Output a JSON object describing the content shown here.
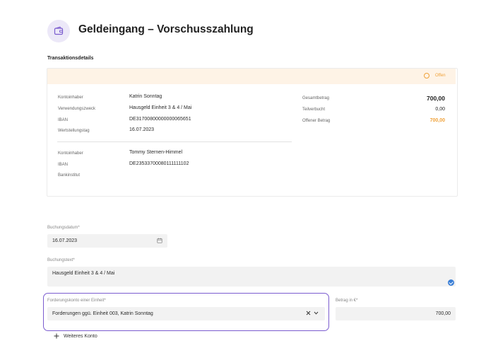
{
  "page": {
    "title": "Geldeingang – Vorschusszahlung",
    "icon": "wallet-icon",
    "section_title": "Transaktionsdetails"
  },
  "transaction": {
    "status": "Offen",
    "status_color": "#f0a23a",
    "sender": {
      "kontoinhaber_label": "Kontoinhaber",
      "kontoinhaber": "Katrin Sonntag",
      "verwendungszweck_label": "Verwendungszweck",
      "verwendungszweck": "Hausgeld Einheit 3 & 4 / Mai",
      "iban_label": "IBAN",
      "iban": "DE31700800000000065651",
      "wertstellungstag_label": "Wertstellungstag",
      "wertstellungstag": "16.07.2023"
    },
    "receiver": {
      "kontoinhaber_label": "Kontoinhaber",
      "kontoinhaber": "Tommy Sternen-Himmel",
      "iban_label": "IBAN",
      "iban": "DE23533700080111111102",
      "bankinstitut_label": "Bankinstitut",
      "bankinstitut": ""
    },
    "summary": {
      "gesamtbetrag_label": "Gesamtbetrag",
      "gesamtbetrag": "700,00",
      "teilverbucht_label": "Teilverbucht",
      "teilverbucht": "0,00",
      "offener_betrag_label": "Offener Betrag",
      "offener_betrag": "700,00"
    }
  },
  "form": {
    "buchungsdatum_label": "Buchungsdatum*",
    "buchungsdatum": "16.07.2023",
    "buchungstext_label": "Buchungstext*",
    "buchungstext": "Hausgeld Einheit 3 & 4 / Mai",
    "forderungskonto_label": "Forderungskonto einer Einheit*",
    "forderungskonto": "Forderungen ggü. Einheit 003, Katrin Sonntag",
    "betrag_label": "Betrag in €*",
    "betrag": "700,00",
    "weiteres_konto": "Weiteres Konto"
  },
  "colors": {
    "accent": "#7b5ccf",
    "warning": "#f0a23a",
    "info": "#3b7fd6"
  }
}
